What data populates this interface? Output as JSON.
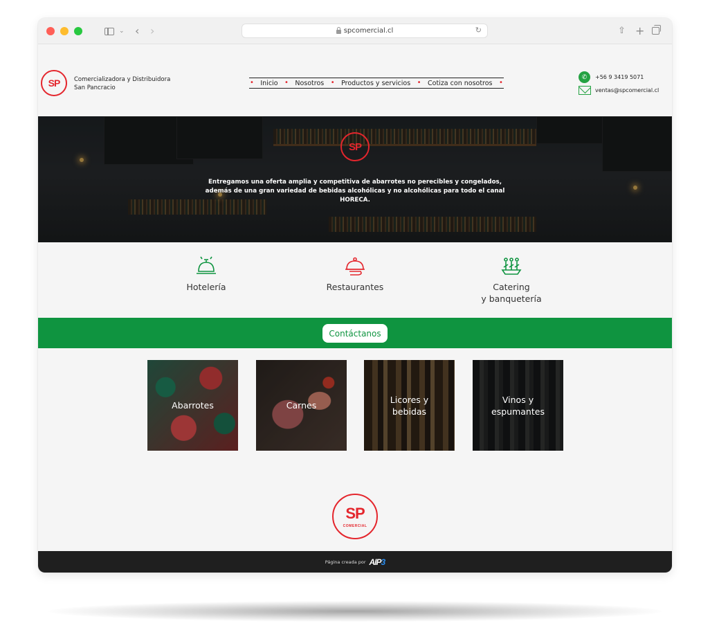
{
  "browser": {
    "url": "spcomercial.cl"
  },
  "brand": {
    "logo_text": "SP",
    "name_line1": "Comercializadora y Distribuidora",
    "name_line2": "San Pancracio"
  },
  "nav": {
    "items": [
      {
        "label": "Inicio"
      },
      {
        "label": "Nosotros"
      },
      {
        "label": "Productos y servicios"
      },
      {
        "label": "Cotiza con nosotros"
      }
    ]
  },
  "contact": {
    "phone": "+56 9 3419 5071",
    "email": "ventas@spcomercial.cl"
  },
  "hero": {
    "logo_text": "SP",
    "text": "Entregamos una oferta amplia y competitiva de abarrotes no perecibles y congelados, además de una gran variedad de bebidas alcohólicas y no alcohólicas para todo el canal HORECA."
  },
  "services": [
    {
      "label": "Hotelería",
      "icon": "hotel-bell-icon"
    },
    {
      "label": "Restaurantes",
      "icon": "serving-dish-icon"
    },
    {
      "label": "Catering\ny banquetería",
      "icon": "catering-tray-icon"
    }
  ],
  "cta": {
    "label": "Contáctanos"
  },
  "categories": [
    {
      "label": "Abarrotes"
    },
    {
      "label": "Carnes"
    },
    {
      "label": "Licores y\nbebidas"
    },
    {
      "label": "Vinos y\nespumantes"
    }
  ],
  "footer_logo": {
    "mark": "SP",
    "sub": "COMERCIAL"
  },
  "footer": {
    "credit": "Página creada por",
    "brand": "AIP",
    "brand_accent": "3"
  },
  "colors": {
    "brand_red": "#e4262d",
    "brand_green": "#0f9440",
    "footer_dark": "#1f1f1f"
  }
}
